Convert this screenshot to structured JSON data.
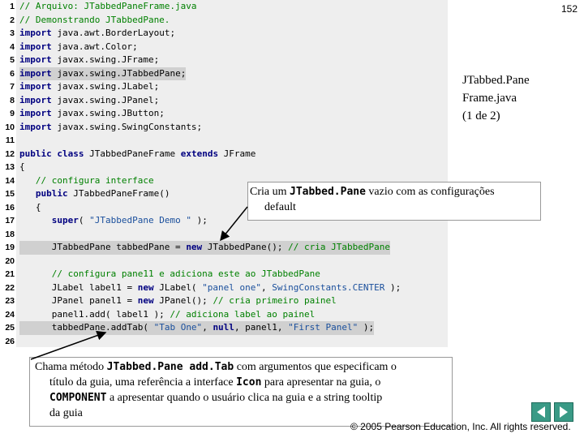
{
  "page_number": "152",
  "title_lines": [
    "JTabbed.Pane",
    "Frame.java",
    "(1 de 2)"
  ],
  "code_lines": [
    {
      "n": "1",
      "segs": [
        [
          "c",
          "// Arquivo: JTabbedPaneFrame.java"
        ]
      ]
    },
    {
      "n": "2",
      "segs": [
        [
          "c",
          "// Demonstrando JTabbedPane."
        ]
      ]
    },
    {
      "n": "3",
      "segs": [
        [
          "k",
          "import"
        ],
        [
          "t",
          " java.awt.BorderLayout;"
        ]
      ]
    },
    {
      "n": "4",
      "segs": [
        [
          "k",
          "import"
        ],
        [
          "t",
          " java.awt.Color;"
        ]
      ]
    },
    {
      "n": "5",
      "segs": [
        [
          "k",
          "import"
        ],
        [
          "t",
          " javax.swing.JFrame;"
        ]
      ]
    },
    {
      "n": "6",
      "segs": [
        [
          "k",
          "import"
        ],
        [
          "t",
          " javax.swing.JTabbedPane;"
        ]
      ],
      "hl": true
    },
    {
      "n": "7",
      "segs": [
        [
          "k",
          "import"
        ],
        [
          "t",
          " javax.swing.JLabel;"
        ]
      ]
    },
    {
      "n": "8",
      "segs": [
        [
          "k",
          "import"
        ],
        [
          "t",
          " javax.swing.JPanel;"
        ]
      ]
    },
    {
      "n": "9",
      "segs": [
        [
          "k",
          "import"
        ],
        [
          "t",
          " javax.swing.JButton;"
        ]
      ]
    },
    {
      "n": "10",
      "segs": [
        [
          "k",
          "import"
        ],
        [
          "t",
          " javax.swing.SwingConstants;"
        ]
      ]
    },
    {
      "n": "11",
      "segs": []
    },
    {
      "n": "12",
      "segs": [
        [
          "k",
          "public class"
        ],
        [
          "t",
          " JTabbedPaneFrame "
        ],
        [
          "k",
          "extends"
        ],
        [
          "t",
          " JFrame"
        ]
      ]
    },
    {
      "n": "13",
      "segs": [
        [
          "t",
          "{"
        ]
      ]
    },
    {
      "n": "14",
      "segs": [
        [
          "c",
          "   // configura interface"
        ]
      ]
    },
    {
      "n": "15",
      "segs": [
        [
          "k",
          "   public"
        ],
        [
          "t",
          " JTabbedPaneFrame()"
        ]
      ]
    },
    {
      "n": "16",
      "segs": [
        [
          "t",
          "   {"
        ]
      ]
    },
    {
      "n": "17",
      "segs": [
        [
          "k",
          "      super"
        ],
        [
          "t",
          "( "
        ],
        [
          "s",
          "\"JTabbedPane Demo \""
        ],
        [
          "t",
          " );"
        ]
      ]
    },
    {
      "n": "18",
      "segs": []
    },
    {
      "n": "19",
      "segs": [
        [
          "t",
          "      JTabbedPane tabbedPane = "
        ],
        [
          "k",
          "new"
        ],
        [
          "t",
          " JTabbedPane(); "
        ],
        [
          "c",
          "// cria JTabbedPane"
        ]
      ],
      "hl": true
    },
    {
      "n": "20",
      "segs": []
    },
    {
      "n": "21",
      "segs": [
        [
          "c",
          "      // configura pane11 e adiciona este ao JTabbedPane"
        ]
      ]
    },
    {
      "n": "22",
      "segs": [
        [
          "t",
          "      JLabel label1 = "
        ],
        [
          "k",
          "new"
        ],
        [
          "t",
          " JLabel( "
        ],
        [
          "s",
          "\"panel one\""
        ],
        [
          "t",
          ", "
        ],
        [
          "s",
          "SwingConstants.CENTER"
        ],
        [
          "t",
          " );"
        ]
      ]
    },
    {
      "n": "23",
      "segs": [
        [
          "t",
          "      JPanel panel1 = "
        ],
        [
          "k",
          "new"
        ],
        [
          "t",
          " JPanel(); "
        ],
        [
          "c",
          "// cria primeiro painel"
        ]
      ]
    },
    {
      "n": "24",
      "segs": [
        [
          "t",
          "      panel1.add( label1 ); "
        ],
        [
          "c",
          "// adiciona label ao painel"
        ]
      ]
    },
    {
      "n": "25",
      "segs": [
        [
          "t",
          "      tabbedPane.addTab( "
        ],
        [
          "s",
          "\"Tab One\""
        ],
        [
          "t",
          ", "
        ],
        [
          "k",
          "null"
        ],
        [
          "t",
          ", panel1, "
        ],
        [
          "s",
          "\"First Panel\""
        ],
        [
          "t",
          " );"
        ]
      ],
      "hl": true
    },
    {
      "n": "26",
      "segs": []
    }
  ],
  "callout1": {
    "pre": "Cria um ",
    "code": "JTabbed.Pane",
    "post": " vazio com as configurações",
    "line2": "default"
  },
  "callout2": {
    "p1": "Chama método ",
    "c1": "JTabbed.Pane add.Tab",
    "p2": " com argumentos que especificam o",
    "line2_pre": "título da guia, uma referência a interface ",
    "c2": "Icon",
    "line2_post": " para apresentar na guia, o",
    "c3": "COMPONENT",
    "line3_post": " a apresentar quando o usuário clica na guia e a string tooltip",
    "line4": "da guia"
  },
  "copyright": "© 2005 Pearson Education, Inc.  All rights reserved.",
  "colors": {
    "comment": "#008000",
    "keyword": "#000080",
    "string": "#1a4f9c",
    "highlight": "#d0d0d0",
    "nav_button": "#3a9a86"
  },
  "icons": [
    "left-arrow-icon",
    "right-arrow-icon"
  ]
}
